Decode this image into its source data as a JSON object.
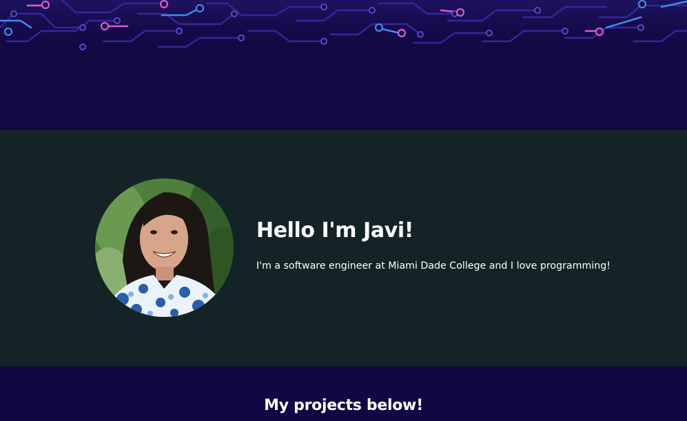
{
  "hero": {
    "background_image": "circuit-pattern-banner",
    "colors": {
      "background": "#120842",
      "trace": "#3a2a9e",
      "accent_pink": "#e05ad6",
      "accent_blue": "#3d8bf0"
    }
  },
  "about": {
    "avatar_alt": "profile-photo",
    "heading": "Hello I'm Javi!",
    "bio": "I'm a software engineer at Miami Dade College and I love programming!",
    "colors": {
      "background": "#142426",
      "text": "#ffffff"
    }
  },
  "projects": {
    "heading": "My projects below!",
    "colors": {
      "background": "#110742",
      "text": "#ffffff"
    }
  }
}
